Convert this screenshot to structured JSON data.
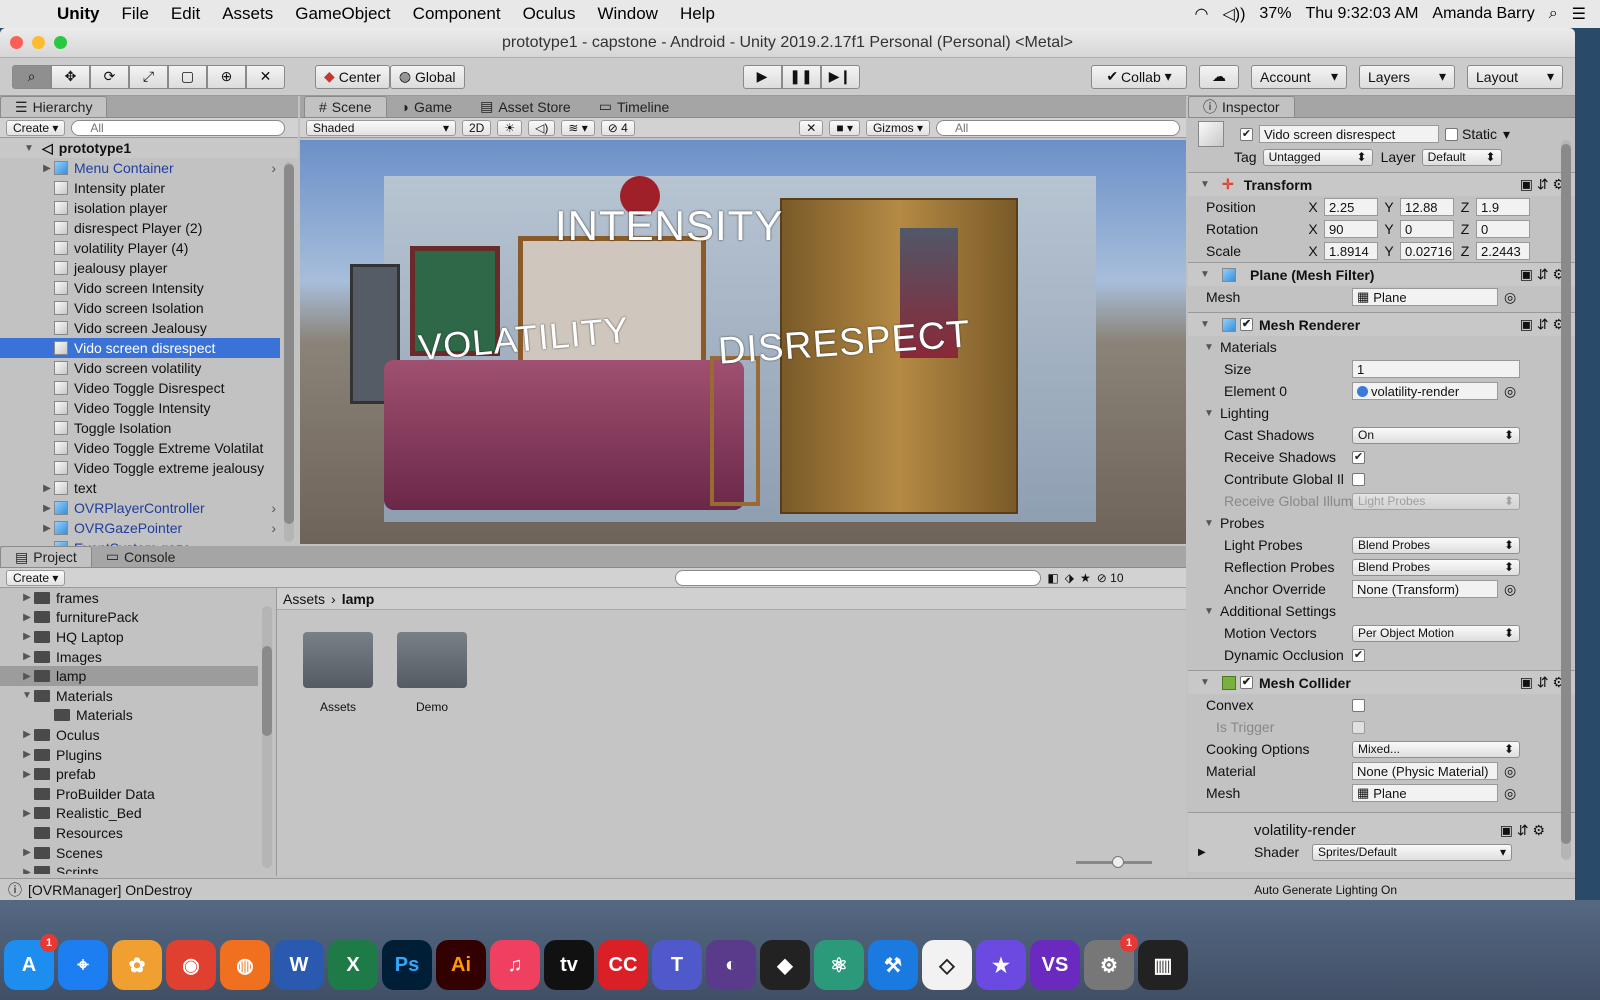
{
  "menubar": {
    "app": "Unity",
    "items": [
      "File",
      "Edit",
      "Assets",
      "GameObject",
      "Component",
      "Oculus",
      "Window",
      "Help"
    ],
    "battery": "37%",
    "clock": "Thu 9:32:03 AM",
    "user": "Amanda Barry"
  },
  "window": {
    "title": "prototype1 - capstone - Android - Unity 2019.2.17f1 Personal (Personal) <Metal>"
  },
  "toolbar": {
    "pivot": "Center",
    "space": "Global",
    "collab": "Collab",
    "account": "Account",
    "layers": "Layers",
    "layout": "Layout"
  },
  "hierarchy": {
    "tab": "Hierarchy",
    "create": "Create",
    "search_placeholder": "All",
    "scene": "prototype1",
    "items": [
      {
        "label": "Menu Container",
        "blue": true,
        "expand": true,
        "arrow": true
      },
      {
        "label": "Intensity plater"
      },
      {
        "label": "isolation player"
      },
      {
        "label": "disrespect Player (2)"
      },
      {
        "label": "volatility Player (4)"
      },
      {
        "label": "jealousy player"
      },
      {
        "label": "Vido screen Intensity"
      },
      {
        "label": "Vido screen Isolation"
      },
      {
        "label": "Vido screen Jealousy"
      },
      {
        "label": "Vido screen disrespect",
        "selected": true
      },
      {
        "label": "Vido screen volatility"
      },
      {
        "label": "Video Toggle Disrespect"
      },
      {
        "label": "Video Toggle Intensity"
      },
      {
        "label": "Toggle Isolation"
      },
      {
        "label": "Video Toggle Extreme Volatilat"
      },
      {
        "label": "Video Toggle extreme jealousy"
      },
      {
        "label": "text",
        "expand": true
      },
      {
        "label": "OVRPlayerController",
        "blue": true,
        "expand": true,
        "arrow": true
      },
      {
        "label": "OVRGazePointer",
        "blue": true,
        "expand": true,
        "arrow": true
      },
      {
        "label": "EventSystem gaze",
        "blue": true,
        "arrow": true
      }
    ]
  },
  "scene_view": {
    "tabs": [
      "Scene",
      "Game",
      "Asset Store",
      "Timeline"
    ],
    "shading": "Shaded",
    "mode_2d": "2D",
    "hidden_count": "4",
    "gizmos": "Gizmos",
    "search_placeholder": "All",
    "labels": {
      "intensity": "INTENSITY",
      "volatility": "VOLATILITY",
      "disrespect": "DISRESPECT"
    }
  },
  "project": {
    "tabs": [
      "Project",
      "Console"
    ],
    "create": "Create",
    "hidden_count": "10",
    "tree": [
      {
        "label": "frames",
        "expand": true,
        "indent": 1
      },
      {
        "label": "furniturePack",
        "expand": true,
        "indent": 1
      },
      {
        "label": "HQ Laptop",
        "expand": true,
        "indent": 1
      },
      {
        "label": "Images",
        "expand": true,
        "indent": 1
      },
      {
        "label": "lamp",
        "expand": true,
        "indent": 1,
        "selected": true
      },
      {
        "label": "Materials",
        "open": true,
        "indent": 1
      },
      {
        "label": "Materials",
        "indent": 2
      },
      {
        "label": "Oculus",
        "expand": true,
        "indent": 1
      },
      {
        "label": "Plugins",
        "expand": true,
        "indent": 1
      },
      {
        "label": "prefab",
        "expand": true,
        "indent": 1
      },
      {
        "label": "ProBuilder Data",
        "indent": 1
      },
      {
        "label": "Realistic_Bed",
        "expand": true,
        "indent": 1
      },
      {
        "label": "Resources",
        "indent": 1
      },
      {
        "label": "Scenes",
        "expand": true,
        "indent": 1
      },
      {
        "label": "Scripts",
        "expand": true,
        "indent": 1
      }
    ],
    "breadcrumb": [
      "Assets",
      "lamp"
    ],
    "folders": [
      "Assets",
      "Demo"
    ]
  },
  "inspector": {
    "tab": "Inspector",
    "object_name": "Vido screen disrespect",
    "static_label": "Static",
    "tag_label": "Tag",
    "tag": "Untagged",
    "layer_label": "Layer",
    "layer": "Default",
    "transform": {
      "title": "Transform",
      "position": {
        "label": "Position",
        "x": "2.25",
        "y": "12.88",
        "z": "1.9"
      },
      "rotation": {
        "label": "Rotation",
        "x": "90",
        "y": "0",
        "z": "0"
      },
      "scale": {
        "label": "Scale",
        "x": "1.8914",
        "y": "0.02716",
        "z": "2.2443"
      }
    },
    "mesh_filter": {
      "title": "Plane (Mesh Filter)",
      "mesh_label": "Mesh",
      "mesh": "Plane"
    },
    "mesh_renderer": {
      "title": "Mesh Renderer",
      "materials": "Materials",
      "size_label": "Size",
      "size": "1",
      "element0_label": "Element 0",
      "element0": "volatility-render",
      "lighting": "Lighting",
      "cast_shadows_label": "Cast Shadows",
      "cast_shadows": "On",
      "receive_shadows_label": "Receive Shadows",
      "contribute_gi_label": "Contribute Global Il",
      "receive_gi_label": "Receive Global Illum",
      "receive_gi": "Light Probes",
      "probes": "Probes",
      "light_probes_label": "Light Probes",
      "light_probes": "Blend Probes",
      "reflection_probes_label": "Reflection Probes",
      "reflection_probes": "Blend Probes",
      "anchor_label": "Anchor Override",
      "anchor": "None (Transform)",
      "additional": "Additional Settings",
      "motion_vectors_label": "Motion Vectors",
      "motion_vectors": "Per Object Motion",
      "dynamic_occlusion_label": "Dynamic Occlusion"
    },
    "mesh_collider": {
      "title": "Mesh Collider",
      "convex_label": "Convex",
      "trigger_label": "Is Trigger",
      "cooking_label": "Cooking Options",
      "cooking": "Mixed...",
      "material_label": "Material",
      "material": "None (Physic Material)",
      "mesh_label": "Mesh",
      "mesh": "Plane"
    },
    "material_asset": {
      "name": "volatility-render",
      "shader_label": "Shader",
      "shader": "Sprites/Default"
    }
  },
  "statusbar": {
    "message": "[OVRManager] OnDestroy",
    "right": "Auto Generate Lighting On"
  },
  "dock": {
    "apps": [
      {
        "name": "App Store",
        "short": "A",
        "color": "#1e8df0",
        "badge": "1"
      },
      {
        "name": "Safari",
        "short": "⌖",
        "color": "#1c7ef0"
      },
      {
        "name": "Photos",
        "short": "✿",
        "color": "#f0a030"
      },
      {
        "name": "Chrome",
        "short": "◉",
        "color": "#e04030"
      },
      {
        "name": "Firefox",
        "short": "◍",
        "color": "#f07020"
      },
      {
        "name": "Word",
        "short": "W",
        "color": "#2a5ab0"
      },
      {
        "name": "Excel",
        "short": "X",
        "color": "#1e7a46"
      },
      {
        "name": "Photoshop",
        "short": "Ps",
        "color": "#001e36",
        "fg": "#31a8ff"
      },
      {
        "name": "Illustrator",
        "short": "Ai",
        "color": "#330000",
        "fg": "#ff9a00"
      },
      {
        "name": "Music",
        "short": "♫",
        "color": "#f04060"
      },
      {
        "name": "TV",
        "short": "tv",
        "color": "#111"
      },
      {
        "name": "Creative Cloud",
        "short": "CC",
        "color": "#da1f26"
      },
      {
        "name": "Teams",
        "short": "T",
        "color": "#5059c9"
      },
      {
        "name": "GitHub",
        "short": "◐",
        "color": "#5a3a8a"
      },
      {
        "name": "Unity Hub",
        "short": "◆",
        "color": "#222"
      },
      {
        "name": "Atom",
        "short": "⚛",
        "color": "#2a9a7a"
      },
      {
        "name": "Xcode",
        "short": "⚒",
        "color": "#1a7ae0"
      },
      {
        "name": "Unity",
        "short": "◇",
        "color": "#f2f2f2",
        "fg": "#222"
      },
      {
        "name": "iMovie",
        "short": "★",
        "color": "#6a4ae0"
      },
      {
        "name": "Visual Studio",
        "short": "VS",
        "color": "#6a2ac0"
      },
      {
        "name": "System Preferences",
        "short": "⚙",
        "color": "#777",
        "badge": "1"
      },
      {
        "name": "Piano",
        "short": "▥",
        "color": "#222"
      }
    ]
  }
}
